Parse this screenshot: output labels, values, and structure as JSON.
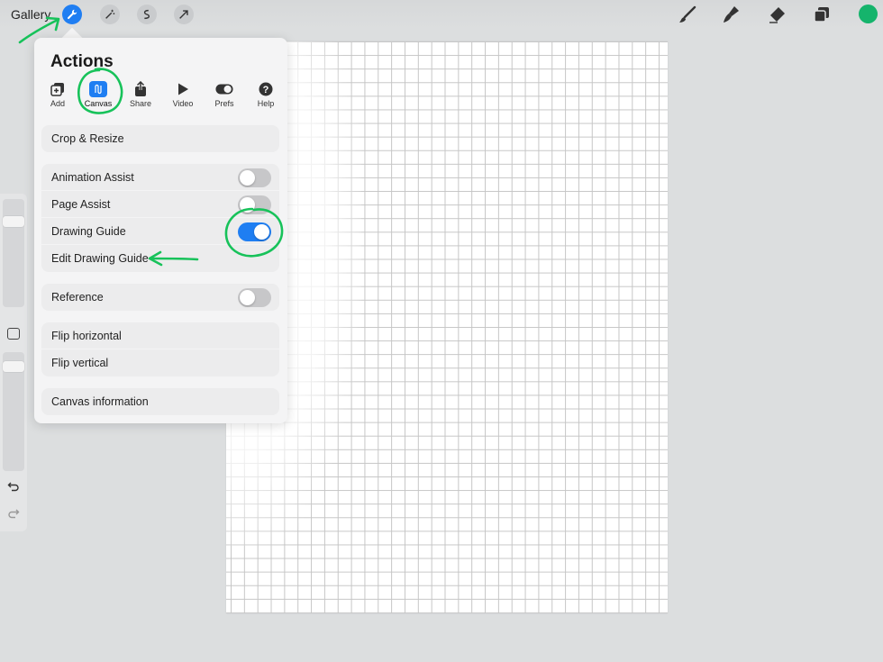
{
  "topbar": {
    "gallery_label": "Gallery",
    "left_tools": [
      "wrench-icon",
      "magic-wand-icon",
      "selection-icon",
      "transform-arrow-icon"
    ],
    "right_tools": [
      "brush-icon",
      "smudge-icon",
      "eraser-icon",
      "layers-icon"
    ],
    "current_color": "#15b46c"
  },
  "actions": {
    "title": "Actions",
    "tabs": [
      {
        "label": "Add",
        "icon": "add-icon"
      },
      {
        "label": "Canvas",
        "icon": "canvas-icon",
        "selected": true
      },
      {
        "label": "Share",
        "icon": "share-icon"
      },
      {
        "label": "Video",
        "icon": "video-icon"
      },
      {
        "label": "Prefs",
        "icon": "prefs-icon"
      },
      {
        "label": "Help",
        "icon": "help-icon"
      }
    ],
    "crop_resize": "Crop & Resize",
    "animation_assist": {
      "label": "Animation Assist",
      "on": false
    },
    "page_assist": {
      "label": "Page Assist",
      "on": false
    },
    "drawing_guide": {
      "label": "Drawing Guide",
      "on": true
    },
    "edit_drawing_guide": "Edit Drawing Guide",
    "reference": {
      "label": "Reference",
      "on": false
    },
    "flip_horizontal": "Flip horizontal",
    "flip_vertical": "Flip vertical",
    "canvas_information": "Canvas information"
  },
  "colors": {
    "accent": "#1f7ef2",
    "annotation": "#17c25a"
  }
}
